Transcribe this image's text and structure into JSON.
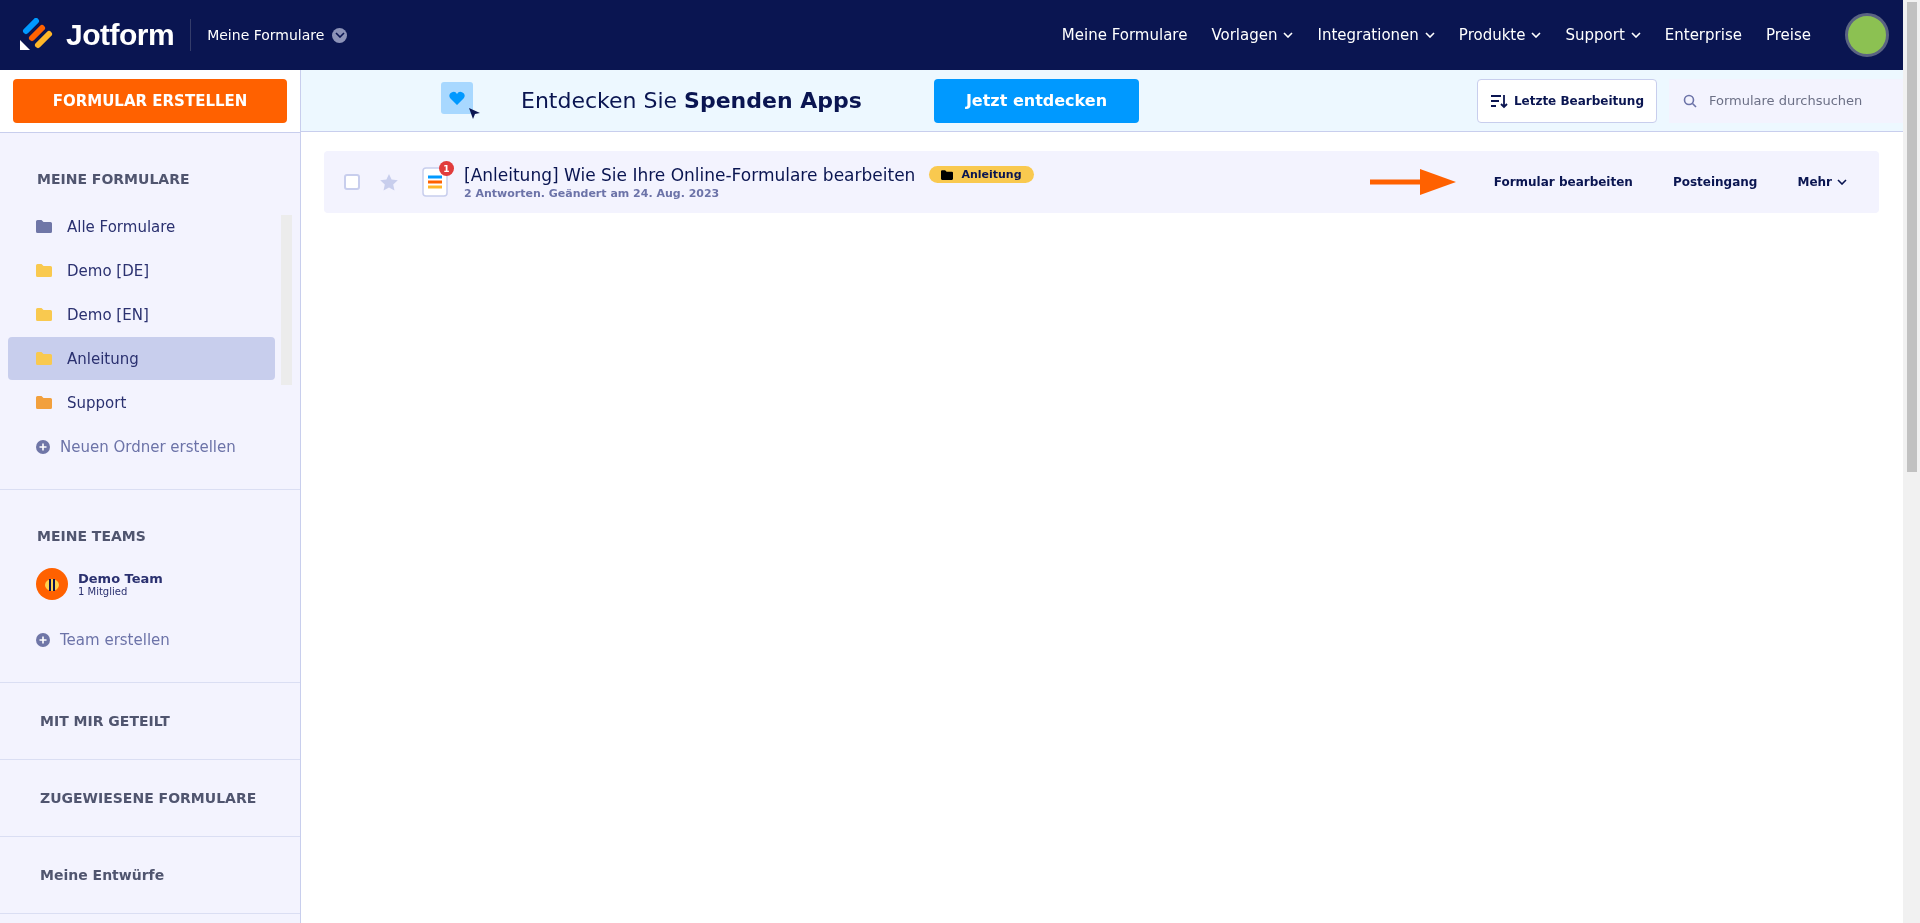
{
  "nav": {
    "logo": "Jotform",
    "workspace": "Meine Formulare",
    "links": [
      {
        "label": "Meine Formulare",
        "dropdown": false
      },
      {
        "label": "Vorlagen",
        "dropdown": true
      },
      {
        "label": "Integrationen",
        "dropdown": true
      },
      {
        "label": "Produkte",
        "dropdown": true
      },
      {
        "label": "Support",
        "dropdown": true
      },
      {
        "label": "Enterprise",
        "dropdown": false
      },
      {
        "label": "Preise",
        "dropdown": false
      }
    ]
  },
  "sidebar": {
    "create_button": "FORMULAR ERSTELLEN",
    "forms_heading": "MEINE FORMULARE",
    "folders": [
      {
        "label": "Alle Formulare",
        "color": "#6f76a7",
        "selected": false
      },
      {
        "label": "Demo [DE]",
        "color": "#f9c94f",
        "selected": false
      },
      {
        "label": "Demo [EN]",
        "color": "#f9c94f",
        "selected": false
      },
      {
        "label": "Anleitung",
        "color": "#f9c94f",
        "selected": true
      },
      {
        "label": "Support",
        "color": "#f2a03d",
        "selected": false
      }
    ],
    "new_folder": "Neuen Ordner erstellen",
    "teams_heading": "MEINE TEAMS",
    "team": {
      "name": "Demo Team",
      "members": "1 Mitglied"
    },
    "new_team": "Team erstellen",
    "sections": [
      "MIT MIR GETEILT",
      "ZUGEWIESENE FORMULARE",
      "Meine Entwürfe"
    ]
  },
  "banner": {
    "text": "Entdecken Sie **Spenden Apps**",
    "button": "Jetzt entdecken"
  },
  "toolbar": {
    "sort": "Letzte Bearbeitung",
    "search_placeholder": "Formulare durchsuchen"
  },
  "forms": [
    {
      "title": "[Anleitung] Wie Sie Ihre Online-Formulare bearbeiten",
      "meta": "2 Antworten. Geändert am 24. Aug. 2023",
      "badge": "1",
      "tag": "Anleitung",
      "checked": false,
      "starred": false,
      "actions": [
        "Formular bearbeiten",
        "Posteingang",
        "Mehr"
      ]
    }
  ]
}
